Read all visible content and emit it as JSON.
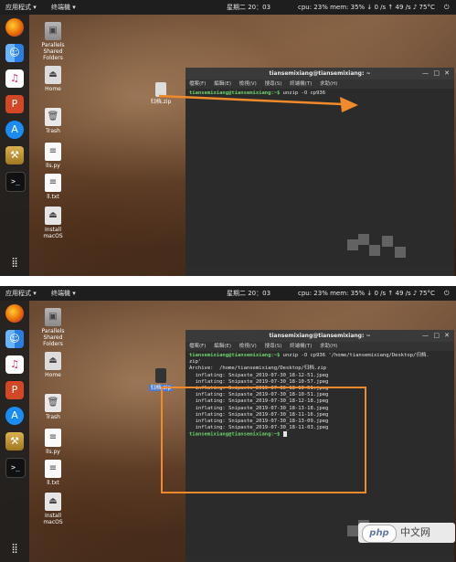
{
  "topbar": {
    "applications": "应用程式 ▾",
    "terminal_app": "终端機 ▾",
    "clock": "星期二 20：03",
    "stats": "cpu: 23% mem: 35% ↓ 0 /s ↑ 49 /s ♪ 75°C",
    "power_icon": "power-icon"
  },
  "desktop": {
    "folders": [
      {
        "label": "Parallels Shared Folders"
      },
      {
        "label": "Home"
      },
      {
        "label": "Trash"
      },
      {
        "label": "lls.py"
      },
      {
        "label": "ll.txt"
      },
      {
        "label": "Install macOS"
      }
    ],
    "zip_label": "归档.zip"
  },
  "terminal": {
    "title": "tiansemixiang@tiansemixiang: ~",
    "menu": [
      "檔案(F)",
      "編輯(E)",
      "檢視(V)",
      "搜尋(S)",
      "終端機(T)",
      "求助(H)"
    ],
    "top_prompt": "tiansemixiang@tiansemixiang:~$",
    "top_command": " unzip -O cp936",
    "bottom_lines": [
      {
        "prompt": "tiansemixiang@tiansemixiang:~$",
        "text": " unzip -O cp936 '/home/tiansemixiang/Desktop/归档."
      },
      {
        "prompt": "",
        "text": "zip'"
      },
      {
        "prompt": "",
        "text": "Archive:  /home/tiansemixiang/Desktop/归档.zip"
      },
      {
        "prompt": "",
        "text": "  inflating: Snipaste_2019-07-30_18-12-51.jpeg"
      },
      {
        "prompt": "",
        "text": "  inflating: Snipaste_2019-07-30_18-10-57.jpeg"
      },
      {
        "prompt": "",
        "text": "  inflating: Snipaste_2019-07-30_18-10-51.jpeg"
      },
      {
        "prompt": "",
        "text": "  inflating: Snipaste_2019-07-30_18-10-51.jpeg"
      },
      {
        "prompt": "",
        "text": "  inflating: Snipaste_2019-07-30_18-12-18.jpeg"
      },
      {
        "prompt": "",
        "text": "  inflating: Snipaste_2019-07-30_18-13-18.jpeg"
      },
      {
        "prompt": "",
        "text": "  inflating: Snipaste_2019-07-30_18-11-16.jpeg"
      },
      {
        "prompt": "",
        "text": "  inflating: Snipaste_2019-07-30_18-13-09.jpeg"
      },
      {
        "prompt": "",
        "text": "  inflating: Snipaste_2019-07-30_18-11-03.jpeg"
      }
    ],
    "bottom_final_prompt": "tiansemixiang@tiansemixiang:~$"
  },
  "watermark": {
    "logo": "php",
    "site": "中文网"
  },
  "colors": {
    "accent_arrow": "#f08a2a",
    "prompt_green": "#6cd36c"
  }
}
